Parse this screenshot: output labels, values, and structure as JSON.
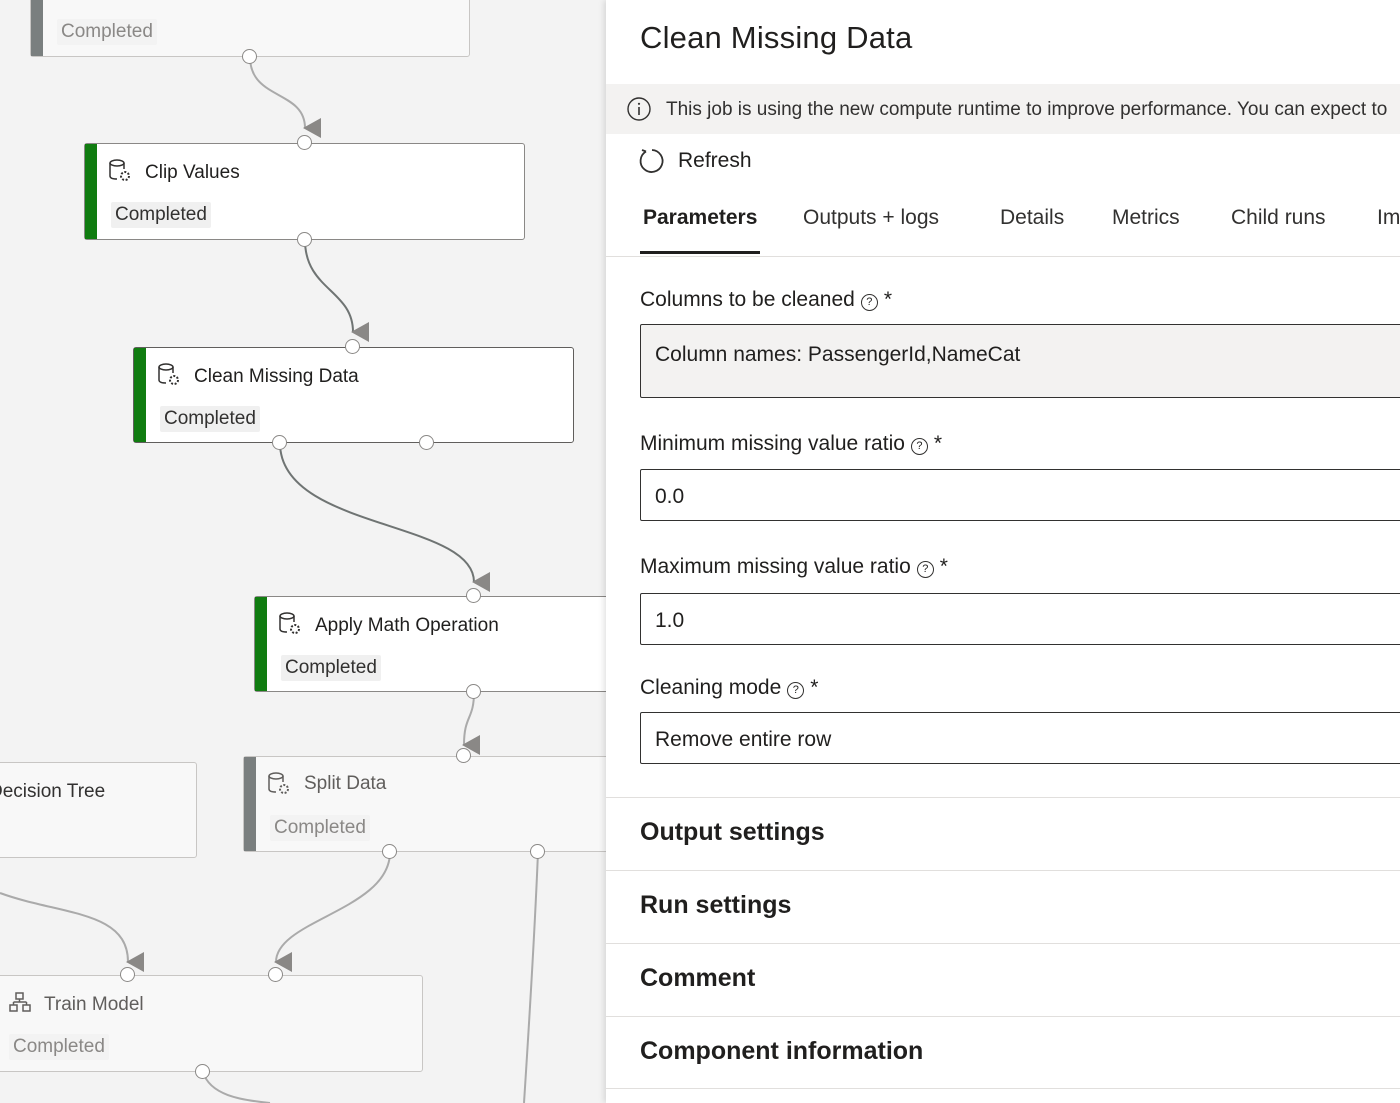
{
  "canvas": {
    "nodes": [
      {
        "title": "",
        "status": "Completed"
      },
      {
        "title": "Clip Values",
        "status": "Completed"
      },
      {
        "title": "Clean Missing Data",
        "status": "Completed"
      },
      {
        "title": "Apply Math Operation",
        "status": "Completed"
      },
      {
        "title": "Decision Tree",
        "status": ""
      },
      {
        "title": "Split Data",
        "status": "Completed"
      },
      {
        "title": "Train Model",
        "status": "Completed"
      }
    ]
  },
  "panel": {
    "title": "Clean Missing Data",
    "info_message": "This job is using the new compute runtime to improve performance. You can expect to",
    "refresh_label": "Refresh",
    "tabs": [
      "Parameters",
      "Outputs + logs",
      "Details",
      "Metrics",
      "Child runs",
      "Im"
    ],
    "active_tab": "Parameters",
    "parameters": {
      "columns_label": "Columns to be cleaned",
      "columns_value": "Column names: PassengerId,NameCat",
      "min_ratio_label": "Minimum missing value ratio",
      "min_ratio_value": "0.0",
      "max_ratio_label": "Maximum missing value ratio",
      "max_ratio_value": "1.0",
      "cleaning_mode_label": "Cleaning mode",
      "cleaning_mode_value": "Remove entire row",
      "help_glyph": "?",
      "required_mark": "*"
    },
    "sections": [
      "Output settings",
      "Run settings",
      "Comment",
      "Component information"
    ]
  },
  "colors": {
    "completed_bar": "#107c10",
    "inactive_bar": "#7a7f7f",
    "edge": "#7f8483"
  }
}
